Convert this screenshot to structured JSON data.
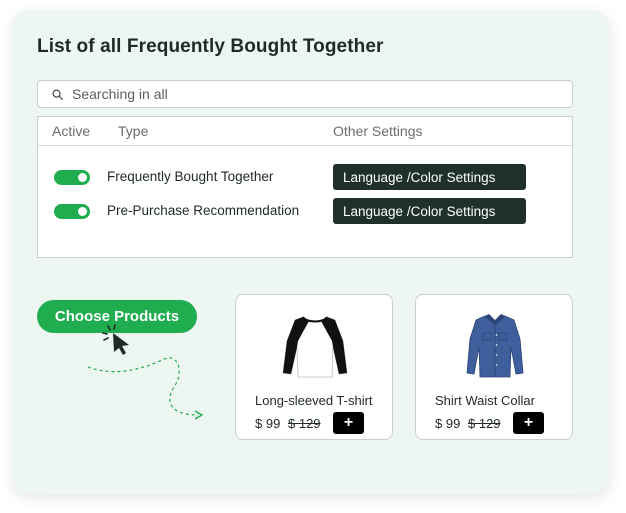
{
  "page": {
    "title": "List of all Frequently Bought Together"
  },
  "search": {
    "placeholder": "Searching in all"
  },
  "table": {
    "headers": [
      "Active",
      "Type",
      "Other Settings"
    ],
    "rows": [
      {
        "active": true,
        "type": "Frequently Bought Together",
        "settings_label": "Language /Color Settings"
      },
      {
        "active": true,
        "type": "Pre-Purchase Recommendation",
        "settings_label": "Language /Color Settings"
      }
    ]
  },
  "choose_products": {
    "label": "Choose Products"
  },
  "products": [
    {
      "name": "Long-sleeved T-shirt",
      "price": "$ 99",
      "old_price": "$ 129",
      "add_label": "+",
      "icon": "raglan-tshirt-image"
    },
    {
      "name": "Shirt Waist Collar",
      "price": "$ 99",
      "old_price": "$ 129",
      "add_label": "+",
      "icon": "denim-shirt-image"
    }
  ],
  "colors": {
    "accent": "#1fad4f",
    "dark_button": "#1f302b",
    "card_bg": "#eef6f1"
  }
}
